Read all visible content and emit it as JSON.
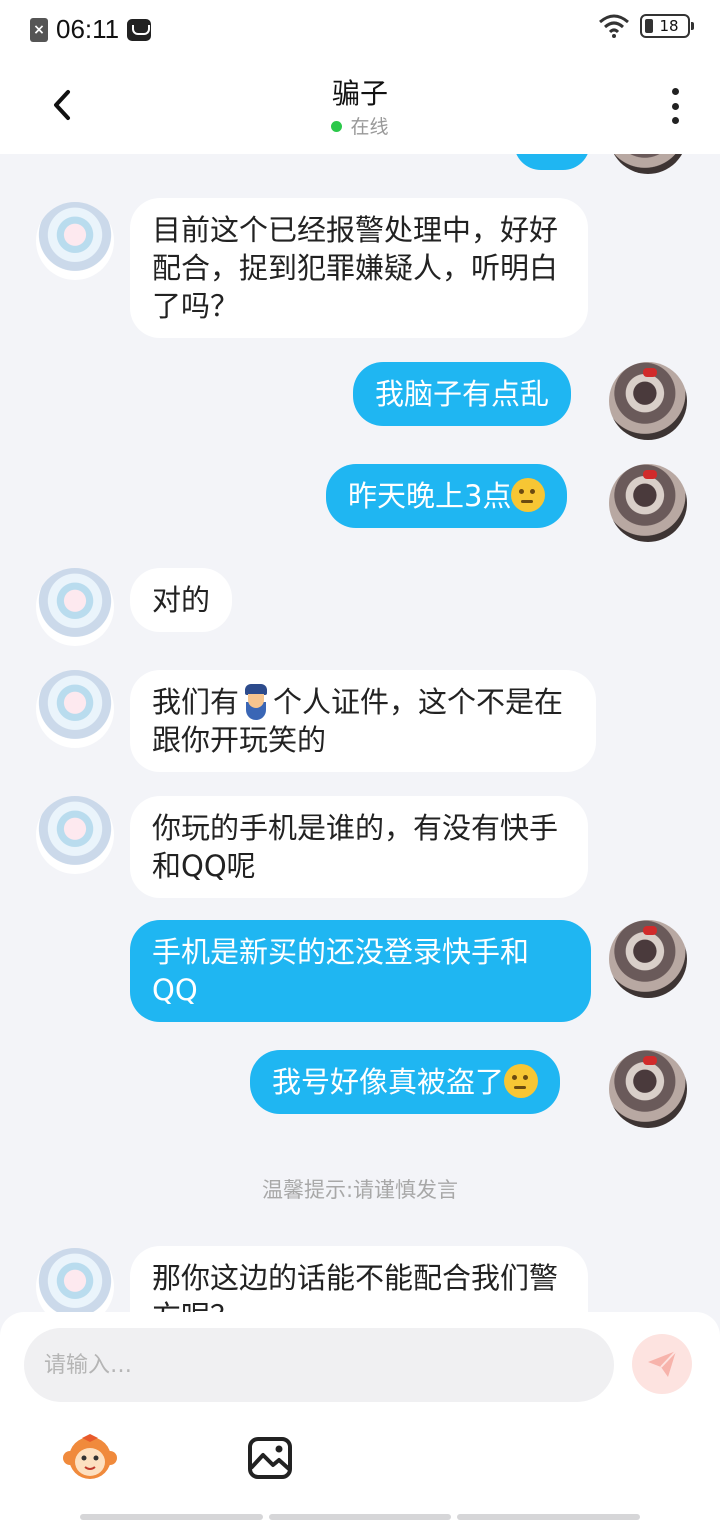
{
  "status_bar": {
    "time": "06:11",
    "battery": "18"
  },
  "header": {
    "title": "骗子",
    "presence": "在线"
  },
  "messages": [
    {
      "from": "other",
      "text": "目前这个已经报警处理中，好好配合，捉到犯罪嫌疑人，听明白了吗？"
    },
    {
      "from": "self",
      "text": "我脑子有点乱"
    },
    {
      "from": "self",
      "text": "昨天晚上3点",
      "emoji": "thinking-face"
    },
    {
      "from": "other",
      "text": "对的"
    },
    {
      "from": "other",
      "text_before_icon": "我们有",
      "icon": "police-officer",
      "text_after_icon": "个人证件，这个不是在跟你开玩笑的"
    },
    {
      "from": "other",
      "text": "你玩的手机是谁的，有没有快手和QQ呢"
    },
    {
      "from": "self",
      "text": "手机是新买的还没登录快手和QQ"
    },
    {
      "from": "self",
      "text": "我号好像真被盗了",
      "emoji": "thinking-face"
    },
    {
      "from": "other",
      "text": "那你这边的话能不能配合我们警方呢？"
    }
  ],
  "system_tip": "温馨提示:请谨慎发言",
  "composer": {
    "placeholder": "请输入…"
  },
  "colors": {
    "outgoing_bubble": "#1fb6f2",
    "incoming_bubble": "#ffffff",
    "online_dot": "#2bc84a",
    "send_button": "#fde3e0"
  }
}
